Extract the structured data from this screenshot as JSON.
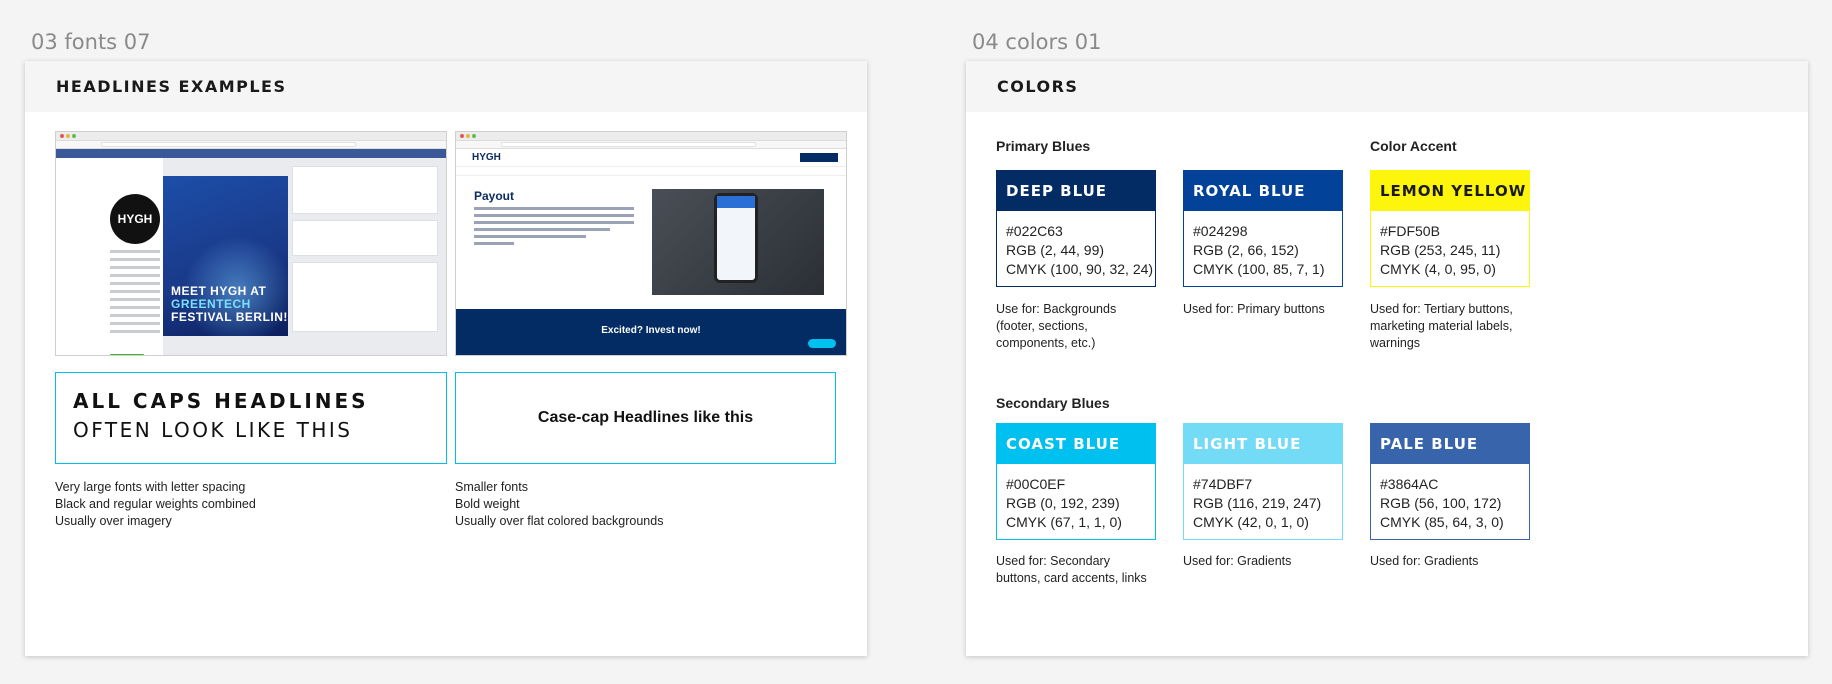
{
  "artboards": {
    "fonts_label": "03 fonts 07",
    "colors_label": "04 colors 01"
  },
  "fonts": {
    "header": "HEADLINES EXAMPLES",
    "facebook_mock": {
      "page_name": "HYGH",
      "cover_line1": "MEET HYGH AT",
      "cover_line2": "GREENTECH",
      "cover_line3": "FESTIVAL BERLIN!"
    },
    "hygh_mock": {
      "logo": "HYGH",
      "title": "Payout",
      "footer_cta": "Excited? Invest now!"
    },
    "caps_example": {
      "line1": "ALL CAPS HEADLINES",
      "line2": "OFTEN LOOK LIKE THIS",
      "notes": [
        "Very large fonts with letter spacing",
        "Black and regular weights combined",
        "Usually over imagery"
      ]
    },
    "casecap_example": {
      "text": "Case-cap Headlines like this",
      "notes": [
        "Smaller fonts",
        "Bold weight",
        "Usually over flat colored backgrounds"
      ]
    }
  },
  "colors": {
    "header": "COLORS",
    "primary_title": "Primary Blues",
    "accent_title": "Color Accent",
    "secondary_title": "Secondary Blues",
    "swatches": [
      {
        "name": "DEEP BLUE",
        "hex": "#022C63",
        "rgb": "RGB (2, 44, 99)",
        "cmyk": "CMYK (100, 90, 32, 24)",
        "usage": "Use for: Backgrounds (footer, sections, components, etc.)",
        "color": "#022C63",
        "text_color": "#FFFFFF"
      },
      {
        "name": "ROYAL BLUE",
        "hex": "#024298",
        "rgb": "RGB (2, 66, 152)",
        "cmyk": "CMYK (100, 85, 7, 1)",
        "usage": "Used for: Primary buttons",
        "color": "#024298",
        "text_color": "#FFFFFF"
      },
      {
        "name": "LEMON YELLOW",
        "hex": "#FDF50B",
        "rgb": "RGB (253, 245, 11)",
        "cmyk": "CMYK (4, 0, 95, 0)",
        "usage": "Used for: Tertiary buttons, marketing material labels, warnings",
        "color": "#FDF50B",
        "text_color": "#1A1A1A"
      },
      {
        "name": "COAST BLUE",
        "hex": "#00C0EF",
        "rgb": "RGB (0, 192, 239)",
        "cmyk": "CMYK (67, 1, 1, 0)",
        "usage": "Used for: Secondary buttons, card accents, links",
        "color": "#00C0EF",
        "text_color": "#FFFFFF"
      },
      {
        "name": "LIGHT BLUE",
        "hex": "#74DBF7",
        "rgb": "RGB (116, 219, 247)",
        "cmyk": "CMYK (42, 0, 1, 0)",
        "usage": "Used for: Gradients",
        "color": "#74DBF7",
        "text_color": "#FFFFFF"
      },
      {
        "name": "PALE BLUE",
        "hex": "#3864AC",
        "rgb": "RGB (56, 100, 172)",
        "cmyk": "CMYK (85, 64, 3, 0)",
        "usage": "Used for: Gradients",
        "color": "#3864AC",
        "text_color": "#FFFFFF"
      }
    ]
  }
}
